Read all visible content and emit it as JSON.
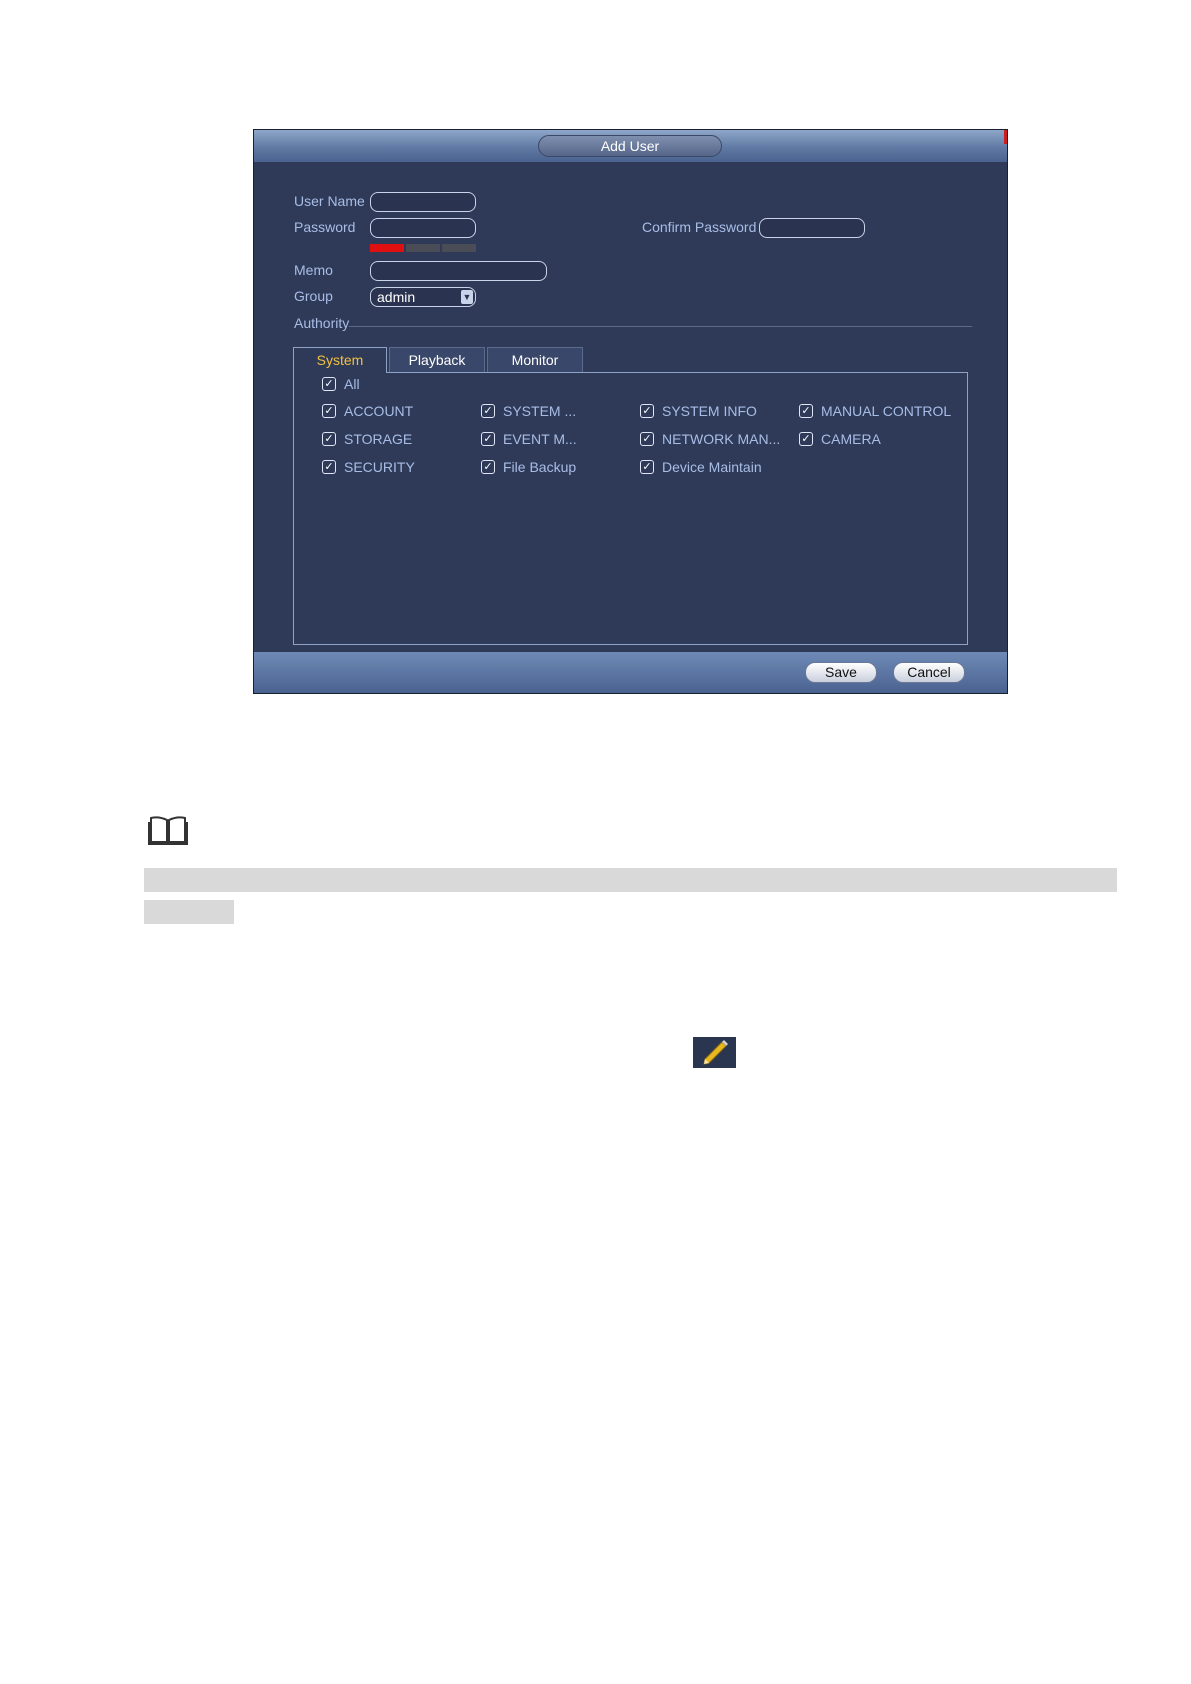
{
  "dialog": {
    "title": "Add User",
    "labels": {
      "username": "User Name",
      "password": "Password",
      "confirm_password": "Confirm Password",
      "memo": "Memo",
      "group": "Group",
      "authority": "Authority"
    },
    "fields": {
      "username": "",
      "password": "",
      "confirm_password": "",
      "memo": "",
      "group": "admin"
    },
    "password_strength_level": 1,
    "password_strength_max": 3,
    "tabs": [
      {
        "label": "System",
        "active": true
      },
      {
        "label": "Playback",
        "active": false
      },
      {
        "label": "Monitor",
        "active": false
      }
    ],
    "permissions": {
      "all": {
        "label": "All",
        "checked": true
      },
      "items": [
        {
          "label": "ACCOUNT",
          "checked": true
        },
        {
          "label": "SYSTEM ...",
          "checked": true
        },
        {
          "label": "SYSTEM INFO",
          "checked": true
        },
        {
          "label": "MANUAL CONTROL",
          "checked": true
        },
        {
          "label": "STORAGE",
          "checked": true
        },
        {
          "label": "EVENT M...",
          "checked": true
        },
        {
          "label": "NETWORK MAN...",
          "checked": true
        },
        {
          "label": "CAMERA",
          "checked": true
        },
        {
          "label": "SECURITY",
          "checked": true
        },
        {
          "label": "File Backup",
          "checked": true
        },
        {
          "label": "Device Maintain",
          "checked": true
        }
      ]
    },
    "buttons": {
      "save": "Save",
      "cancel": "Cancel"
    }
  },
  "page": {
    "icons": [
      "book-icon",
      "pencil-icon"
    ]
  }
}
